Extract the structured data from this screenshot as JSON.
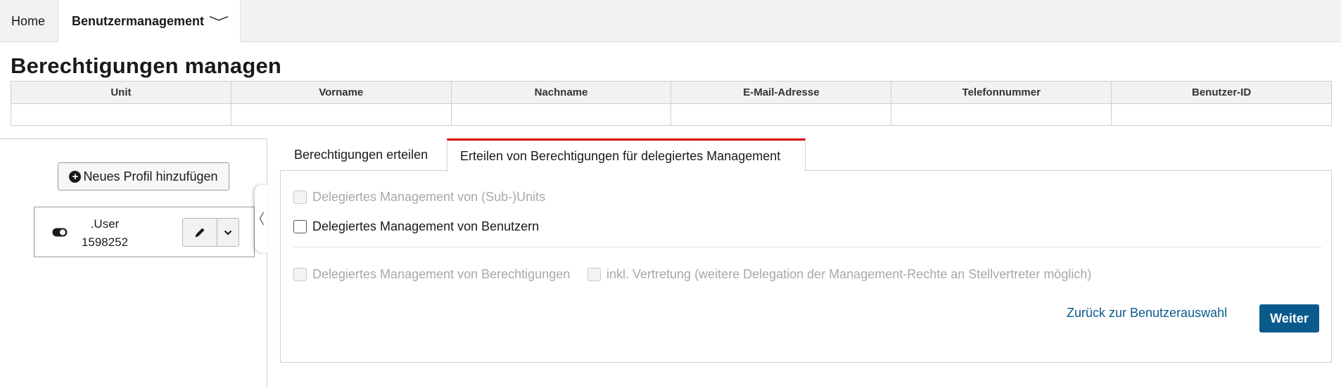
{
  "nav": {
    "home": "Home",
    "active": "Benutzermanagement"
  },
  "page_title": "Berechtigungen managen",
  "user_table": {
    "headers": [
      "Unit",
      "Vorname",
      "Nachname",
      "E-Mail-Adresse",
      "Telefonnummer",
      "Benutzer-ID"
    ],
    "row": [
      "",
      "",
      "",
      "",
      "",
      ""
    ]
  },
  "left_panel": {
    "add_profile_label": "Neues Profil hinzufügen",
    "profile": {
      "line1": ".User",
      "line2": "1598252"
    }
  },
  "tabs": [
    {
      "label": "Berechtigungen erteilen",
      "active": false
    },
    {
      "label": "Erteilen von Berechtigungen für delegiertes Management",
      "active": true
    }
  ],
  "options": {
    "units": {
      "label": "Delegiertes Management von (Sub-)Units",
      "disabled": true,
      "checked": false
    },
    "users": {
      "label": "Delegiertes Management von Benutzern",
      "disabled": false,
      "checked": false
    },
    "permissions": {
      "label": "Delegiertes Management von Berechtigungen",
      "disabled": true,
      "checked": false
    },
    "deputy": {
      "label": "inkl. Vertretung (weitere Delegation der Management-Rechte an Stellvertreter möglich)",
      "disabled": true,
      "checked": false
    }
  },
  "actions": {
    "back_label": "Zurück zur Benutzerauswahl",
    "next_label": "Weiter"
  },
  "colors": {
    "accent": "#0a5a8c",
    "active_tab_border": "#d50000",
    "disabled_text": "#a8a8a8"
  },
  "icons": {
    "add": "plus-circle-icon",
    "toggle": "toggle-icon",
    "edit": "pencil-icon",
    "dropdown": "chevron-down-icon",
    "collapse": "chevron-left-icon"
  }
}
